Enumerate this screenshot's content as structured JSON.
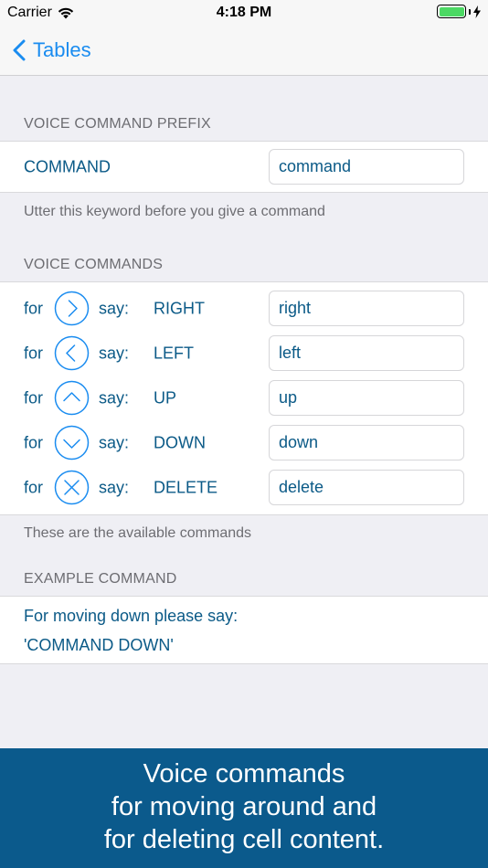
{
  "status_bar": {
    "carrier": "Carrier",
    "time": "4:18 PM"
  },
  "nav": {
    "back_label": "Tables"
  },
  "prefix_section": {
    "header": "VOICE COMMAND PREFIX",
    "row_label": "COMMAND",
    "value": "command",
    "footer": "Utter this keyword before you give a command"
  },
  "commands_section": {
    "header": "VOICE COMMANDS",
    "for_label": "for",
    "say_label": "say:",
    "items": [
      {
        "icon": "chevron-right-icon",
        "name": "RIGHT",
        "value": "right"
      },
      {
        "icon": "chevron-left-icon",
        "name": "LEFT",
        "value": "left"
      },
      {
        "icon": "chevron-up-icon",
        "name": "UP",
        "value": "up"
      },
      {
        "icon": "chevron-down-icon",
        "name": "DOWN",
        "value": "down"
      },
      {
        "icon": "close-icon",
        "name": "DELETE",
        "value": "delete"
      }
    ],
    "footer": "These are the available commands"
  },
  "example_section": {
    "header": "EXAMPLE COMMAND",
    "line1": "For moving down please say:",
    "line2": "'COMMAND DOWN'"
  },
  "banner": {
    "line1": "Voice commands",
    "line2": "for moving around and",
    "line3": "for deleting cell content."
  },
  "colors": {
    "accent": "#1a8cf0",
    "label_text": "#0b5a87",
    "banner_bg": "#0b5a8c",
    "battery": "#4cd964"
  }
}
